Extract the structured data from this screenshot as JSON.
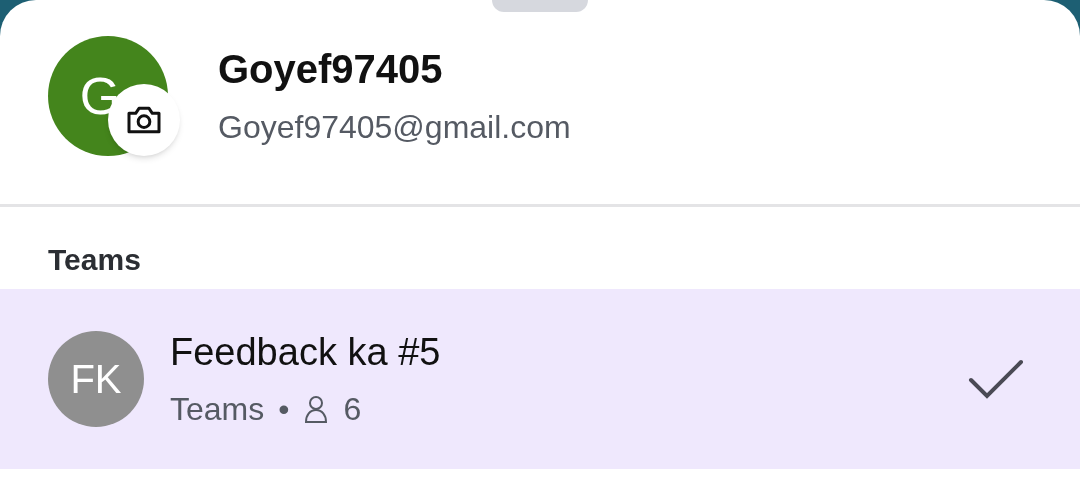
{
  "profile": {
    "avatar_letter": "G",
    "name": "Goyef97405",
    "email": "Goyef97405@gmail.com"
  },
  "section_title": "Teams",
  "teams": [
    {
      "initials": "FK",
      "name": "Feedback ka #5",
      "type": "Teams",
      "separator": "•",
      "members": "6",
      "selected": true
    }
  ]
}
